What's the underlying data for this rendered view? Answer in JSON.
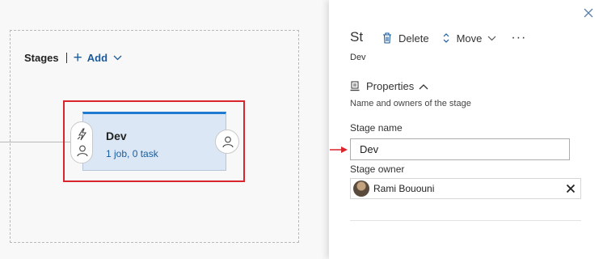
{
  "canvas": {
    "stages_title": "Stages",
    "add_label": "Add",
    "stage": {
      "name": "Dev",
      "info": "1 job, 0 task"
    }
  },
  "panel": {
    "title": "St",
    "subtitle": "Dev",
    "toolbar": {
      "delete_label": "Delete",
      "move_label": "Move",
      "more_label": "···"
    },
    "properties": {
      "heading": "Properties",
      "description": "Name and owners of the stage",
      "stage_name_label": "Stage name",
      "stage_name_value": "Dev",
      "stage_owner_label": "Stage owner",
      "stage_owner_name": "Rami Bououni"
    }
  },
  "colors": {
    "accent": "#1f7bd1",
    "link": "#1a5b9c",
    "highlight": "#d9262c",
    "card_bg": "#dbe7f4"
  },
  "icons": [
    "plus-icon",
    "chevron-down-icon",
    "trigger-icon",
    "person-icon",
    "close-icon",
    "trash-icon",
    "move-icon",
    "more-icon",
    "properties-icon",
    "chevron-up-icon",
    "red-arrow-icon",
    "clear-icon"
  ]
}
